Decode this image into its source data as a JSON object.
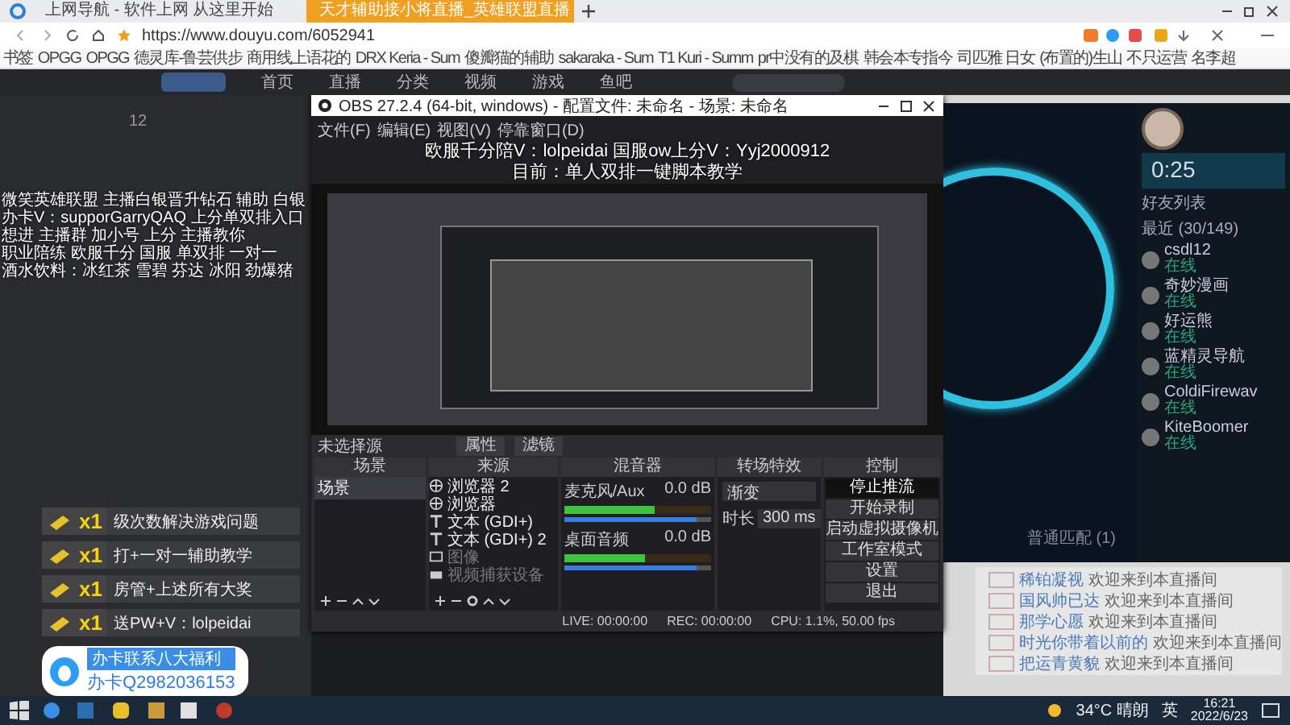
{
  "browser": {
    "tabs": [
      {
        "label": "上网导航 - 软件上网 从这里开始",
        "selected": false
      },
      {
        "label": "天才辅助接小将直播_英雄联盟直播",
        "selected": true
      }
    ],
    "url": "https://www.douyu.com/6052941",
    "bookmarks": [
      "书签",
      "OPGG",
      "OPGG",
      "德灵库-鲁芸供步",
      "商用线上语花的",
      "DRX Keria - Sum",
      "傻瓣猫的辅助",
      "sakaraka - Sum",
      "T1 Kuri - Summ",
      "pr中没有的及棋",
      "韩会本专指今",
      "司匹雅 日女",
      "(布置的)生山",
      "不只运营",
      "名李超"
    ]
  },
  "site_nav": [
    "首页",
    "直播",
    "分类",
    "视频",
    "游戏",
    "鱼吧"
  ],
  "stream": {
    "viewer_count": "12",
    "overlay_lines": [
      "微笑英雄联盟 主播白银晋升钻石 辅助 白银",
      "办卡V：supporGarryQAQ 上分单双排入口",
      "想进 主播群 加小号 上分 主播教你",
      "职业陪练 欧服千分 国服 单双排 一对一",
      "酒水饮料：冰红茶 雪碧 芬达 冰阳 劲爆猪"
    ],
    "gifts": [
      {
        "count": "x1",
        "text": "级次数解决游戏问题"
      },
      {
        "count": "x1",
        "text": "打+一对一辅助教学"
      },
      {
        "count": "x1",
        "text": "房管+上述所有大奖"
      },
      {
        "count": "x1",
        "text": "送PW+V：lolpeidai"
      }
    ],
    "promo": {
      "title": "办卡联系八大福利",
      "text": "办卡Q2982036153"
    }
  },
  "obs": {
    "title": "OBS 27.2.4 (64-bit, windows) - 配置文件: 未命名 - 场景: 未命名",
    "menu": [
      "文件(F)",
      "编辑(E)",
      "视图(V)",
      "停靠窗口(D)"
    ],
    "overlay_lines": [
      "欧服千分陪V：lolpeidai 国服ow上分V：Yyj2000912",
      "目前：单人双排一键脚本教学"
    ],
    "no_source": "未选择源",
    "properties": "属性",
    "filters": "滤镜",
    "docks": [
      "场景",
      "来源",
      "混音器",
      "转场特效",
      "控制"
    ],
    "scenes": [
      "场景"
    ],
    "sources": [
      {
        "kind": "browser",
        "name": "浏览器 2",
        "visible": true
      },
      {
        "kind": "browser",
        "name": "浏览器",
        "visible": true
      },
      {
        "kind": "text",
        "name": "文本 (GDI+)",
        "visible": true
      },
      {
        "kind": "text",
        "name": "文本 (GDI+) 2",
        "visible": true
      },
      {
        "kind": "image",
        "name": "图像",
        "visible": false
      },
      {
        "kind": "camera",
        "name": "视频捕获设备",
        "visible": false
      }
    ],
    "channels": [
      {
        "name": "麦克风/Aux",
        "reading": "0.0 dB",
        "level": 0.62,
        "volume": {
          "level": 0.9
        }
      },
      {
        "name": "桌面音频",
        "reading": "0.0 dB",
        "level": 0.55,
        "volume": {
          "level": 0.9
        }
      }
    ],
    "transition": "渐变",
    "duration_label": "时长",
    "duration": "300 ms",
    "controls": [
      {
        "label": "停止推流",
        "selected": true
      },
      {
        "label": "开始录制",
        "selected": false
      },
      {
        "label": "启动虚拟摄像机",
        "selected": false
      },
      {
        "label": "工作室模式",
        "selected": false
      },
      {
        "label": "设置",
        "selected": false
      },
      {
        "label": "退出",
        "selected": false
      }
    ],
    "status": [
      "LIVE: 00:00:00",
      "REC: 00:00:00",
      "CPU: 1.1%, 50.00 fps"
    ]
  },
  "lol": {
    "timer": "0:25",
    "friends_title": "好友列表",
    "group": "最近 (30/149)",
    "queue_label": "普通匹配 (1)",
    "friends": [
      {
        "name": "csdl12",
        "status": "在线"
      },
      {
        "name": "奇妙漫画",
        "status": "在线"
      },
      {
        "name": "好运熊",
        "status": "在线"
      },
      {
        "name": "蓝精灵导航",
        "status": "在线"
      },
      {
        "name": "ColdiFirewav",
        "status": "在线"
      },
      {
        "name": "KiteBoomer",
        "status": "在线"
      }
    ]
  },
  "chat": [
    {
      "user": "稀铂凝视",
      "text": "欢迎来到本直播间"
    },
    {
      "user": "国风帅已达",
      "text": "欢迎来到本直播间"
    },
    {
      "user": "那学心愿",
      "text": "欢迎来到本直播间"
    },
    {
      "user": "时光你带着以前的",
      "text": "欢迎来到本直播间"
    },
    {
      "user": "把运青黄貌",
      "text": "欢迎来到本直播间"
    }
  ],
  "taskbar": {
    "weather": "34°C 晴朗",
    "ime": "英",
    "time": "16:21",
    "date": "2022/6/23"
  }
}
